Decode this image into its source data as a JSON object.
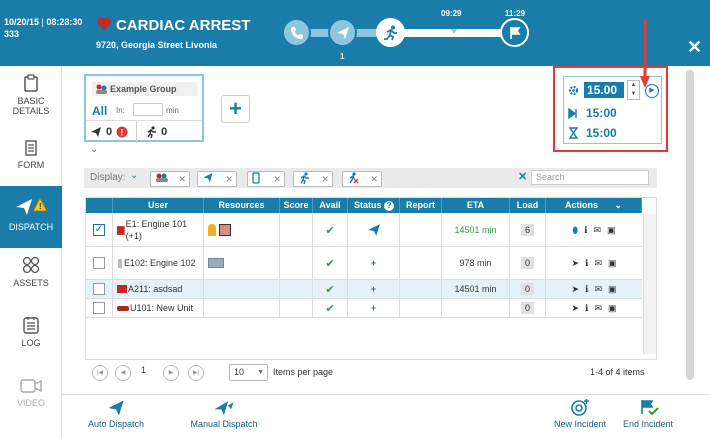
{
  "header": {
    "date": "10/20/15",
    "time": "08:28:30",
    "incident_id": "333",
    "title": "CARDIAC ARREST",
    "address": "9720, Georgia Street Livonia",
    "close_label": "✕",
    "steps": [
      {
        "time": "",
        "count": ""
      },
      {
        "time": "",
        "count": "1"
      },
      {
        "time": "",
        "count": ""
      },
      {
        "time": "09:29",
        "count": ""
      },
      {
        "time": "11:29",
        "count": ""
      }
    ]
  },
  "sidebar": [
    {
      "label": "BASIC DETAILS",
      "icon": "clipboard-icon"
    },
    {
      "label": "FORM",
      "icon": "form-icon"
    },
    {
      "label": "DISPATCH",
      "icon": "dispatch-icon"
    },
    {
      "label": "ASSETS",
      "icon": "assets-icon"
    },
    {
      "label": "LOG",
      "icon": "log-icon"
    },
    {
      "label": "VIDEO",
      "icon": "video-icon"
    }
  ],
  "group": {
    "name": "Example Group",
    "all_label": "All",
    "in_label": "In:",
    "min_label": "min",
    "dispatched_count": "0",
    "enroute_count": "0"
  },
  "timer": {
    "value1": "15.00",
    "value2": "15:00",
    "value3": "15:00"
  },
  "display": {
    "label": "Display:",
    "search_placeholder": "Search"
  },
  "table": {
    "columns": [
      "User",
      "Resources",
      "Score",
      "Avail",
      "Status",
      "Report",
      "ETA",
      "Load",
      "Actions"
    ],
    "rows": [
      {
        "user": "E1: Engine 101 (+1)",
        "checked": true,
        "eta": "14501 min",
        "load": "6",
        "status": "sent"
      },
      {
        "user": "E102: Engine 102",
        "checked": false,
        "eta": "978 min",
        "load": "0",
        "status": "plus"
      },
      {
        "user": "A211: asdsad",
        "checked": false,
        "eta": "14501 min",
        "load": "0",
        "status": "plus"
      },
      {
        "user": "U101: New Unit",
        "checked": false,
        "eta": "",
        "load": "0",
        "status": "plus"
      }
    ]
  },
  "pager": {
    "page": "1",
    "per_page": "10",
    "per_page_label": "Items per page",
    "summary": "1-4 of 4 items"
  },
  "bottom": {
    "auto_dispatch": "Auto Dispatch",
    "manual_dispatch": "Manual Dispatch",
    "new_incident": "New Incident",
    "end_incident": "End Incident"
  },
  "colors": {
    "primary": "#1a7ca8",
    "highlight": "#e53935",
    "eta_green": "#2e9e3e"
  }
}
